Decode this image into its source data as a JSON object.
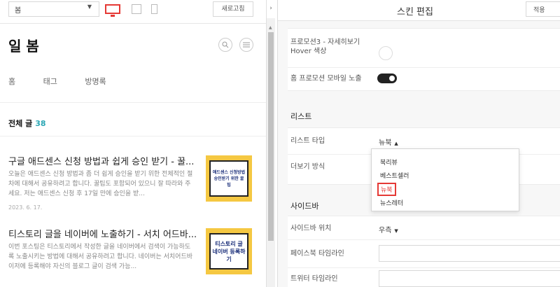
{
  "preview": {
    "skin_select": "봄",
    "refresh_label": "새로고침",
    "blog_title": "일 봄",
    "nav": [
      "홈",
      "태그",
      "방명록"
    ],
    "all_posts_label": "전체 글",
    "all_posts_count": "38",
    "posts": [
      {
        "title": "구글 애드센스 신청 방법과 쉽게 승인 받기 - 꿀...",
        "excerpt": "오늘은 애드센스 신청 방법과 좀 더 쉽게 승인을 받기 위한 전체적인 절차에 대해서 공유하려고 합니다. 꿀팁도 포함되어 있으니 잘 따라와 주세요. 저는 애드센스 신청 후 17일 만에 승인을 받...",
        "date": "2023. 6. 17.",
        "thumb": "애드센스 신청방법\n승인받기 위한 꿀팁"
      },
      {
        "title": "티스토리 글을 네이버에 노출하기 - 서치 어드바...",
        "excerpt": "이번 포스팅은 티스토리에서 작성한 글을 네이버에서 검색이 가능하도록 노출시키는 방법에 대해서 공유하려고 합니다. 네이버는 서치어드바이저에 등록해야 자신의 블로그 글이 검색 가능...",
        "date": "",
        "thumb": "티스토리 글\n네이버 등록하기"
      }
    ]
  },
  "panel": {
    "title": "스킨 편집",
    "apply_label": "적용",
    "promo3_hover_label": "프로모션3 - 자세히보기\nHover 색상",
    "promo_mobile_label": "홈 프로모션 모바일 노출",
    "promo_mobile_on": true,
    "list_section": "리스트",
    "list_type_label": "리스트 타입",
    "list_type_value": "뉴북",
    "more_method_label": "더보기 방식",
    "list_type_options": [
      "북리뷰",
      "베스트셀러",
      "뉴북",
      "뉴스레터"
    ],
    "list_type_selected": "뉴북",
    "sidebar_section": "사이드바",
    "sidebar_pos_label": "사이드바 위치",
    "sidebar_pos_value": "우측",
    "facebook_label": "페이스북 타임라인",
    "twitter_label": "트위터 타임라인"
  },
  "colors": {
    "accent_teal": "#2aa6b4",
    "highlight_red": "#e53935",
    "thumb_yellow": "#f5c842"
  }
}
